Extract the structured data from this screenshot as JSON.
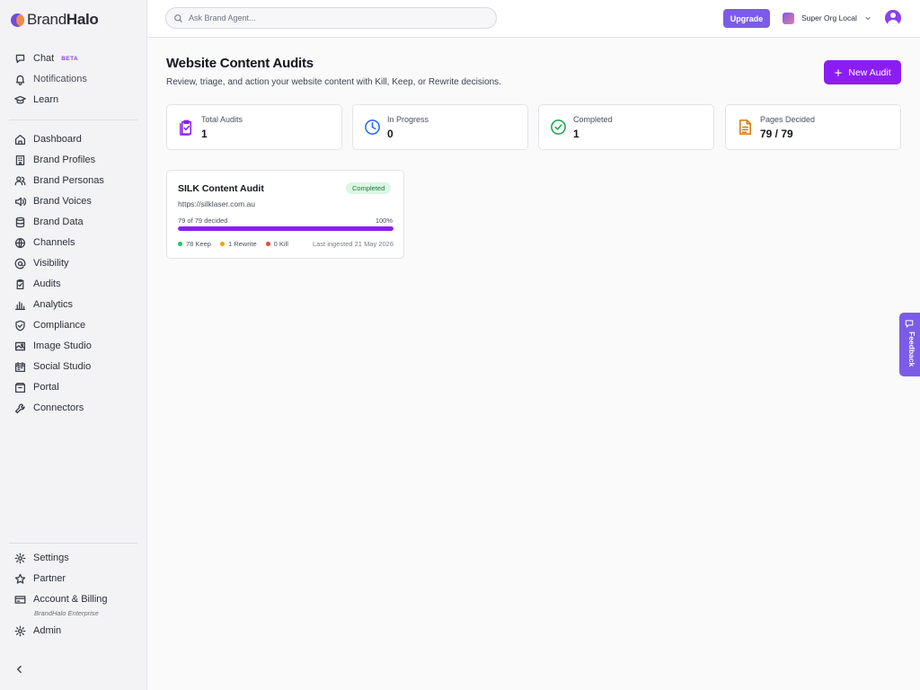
{
  "brand": {
    "name_light": "Brand",
    "name_bold": "Halo"
  },
  "sidebar": {
    "top_items": [
      {
        "label": "Chat",
        "badge": "BETA",
        "icon": "chat-icon"
      },
      {
        "label": "Notifications",
        "icon": "bell-icon"
      },
      {
        "label": "Learn",
        "icon": "graduation-cap-icon"
      }
    ],
    "main_items": [
      {
        "label": "Dashboard",
        "icon": "home-icon"
      },
      {
        "label": "Brand Profiles",
        "icon": "building-icon"
      },
      {
        "label": "Brand Personas",
        "icon": "users-icon"
      },
      {
        "label": "Brand Voices",
        "icon": "speaker-icon"
      },
      {
        "label": "Brand Data",
        "icon": "database-icon"
      },
      {
        "label": "Channels",
        "icon": "globe-icon"
      },
      {
        "label": "Visibility",
        "icon": "at-sign-icon"
      },
      {
        "label": "Audits",
        "icon": "clipboard-icon"
      },
      {
        "label": "Analytics",
        "icon": "bar-chart-icon"
      },
      {
        "label": "Compliance",
        "icon": "shield-check-icon"
      },
      {
        "label": "Image Studio",
        "icon": "image-icon"
      },
      {
        "label": "Social Studio",
        "icon": "calendar-icon"
      },
      {
        "label": "Portal",
        "icon": "portal-icon"
      },
      {
        "label": "Connectors",
        "icon": "wrench-icon"
      }
    ],
    "bottom_items": [
      {
        "label": "Settings",
        "icon": "gear-icon"
      },
      {
        "label": "Partner",
        "icon": "star-icon"
      },
      {
        "label": "Account & Billing",
        "icon": "credit-card-icon",
        "note": "BrandHalo Enterprise"
      },
      {
        "label": "Admin",
        "icon": "gear-icon"
      }
    ]
  },
  "topbar": {
    "search_placeholder": "Ask Brand Agent...",
    "upgrade_label": "Upgrade",
    "org_name": "Super Org Local"
  },
  "main": {
    "title": "Website Content Audits",
    "subtitle": "Review, triage, and action your website content with Kill, Keep, or Rewrite decisions.",
    "new_audit_label": "New Audit",
    "stats": [
      {
        "label": "Total Audits",
        "value": "1",
        "icon": "clipboard-check-icon",
        "color": "#8c1df2"
      },
      {
        "label": "In Progress",
        "value": "0",
        "icon": "clock-icon",
        "color": "#2563eb"
      },
      {
        "label": "Completed",
        "value": "1",
        "icon": "check-circle-icon",
        "color": "#16a34a"
      },
      {
        "label": "Pages Decided",
        "value": "79 / 79",
        "icon": "document-icon",
        "color": "#d97706"
      }
    ],
    "audit_card": {
      "title": "SILK Content Audit",
      "status": "Completed",
      "url": "https://silklaser.com.au",
      "progress_label": "79 of 79 decided",
      "progress_pct_label": "100%",
      "progress": 1.0,
      "keep_label": "78 Keep",
      "rewrite_label": "1 Rewrite",
      "kill_label": "0 Kill",
      "keep_color": "#22c55e",
      "rewrite_color": "#f59e0b",
      "kill_color": "#ef4444",
      "last_ingested": "Last ingested 21 May 2026"
    }
  },
  "feedback_label": "Feedback",
  "colors": {
    "accent": "#8c1df2",
    "upgrade": "#7b5ce6"
  }
}
